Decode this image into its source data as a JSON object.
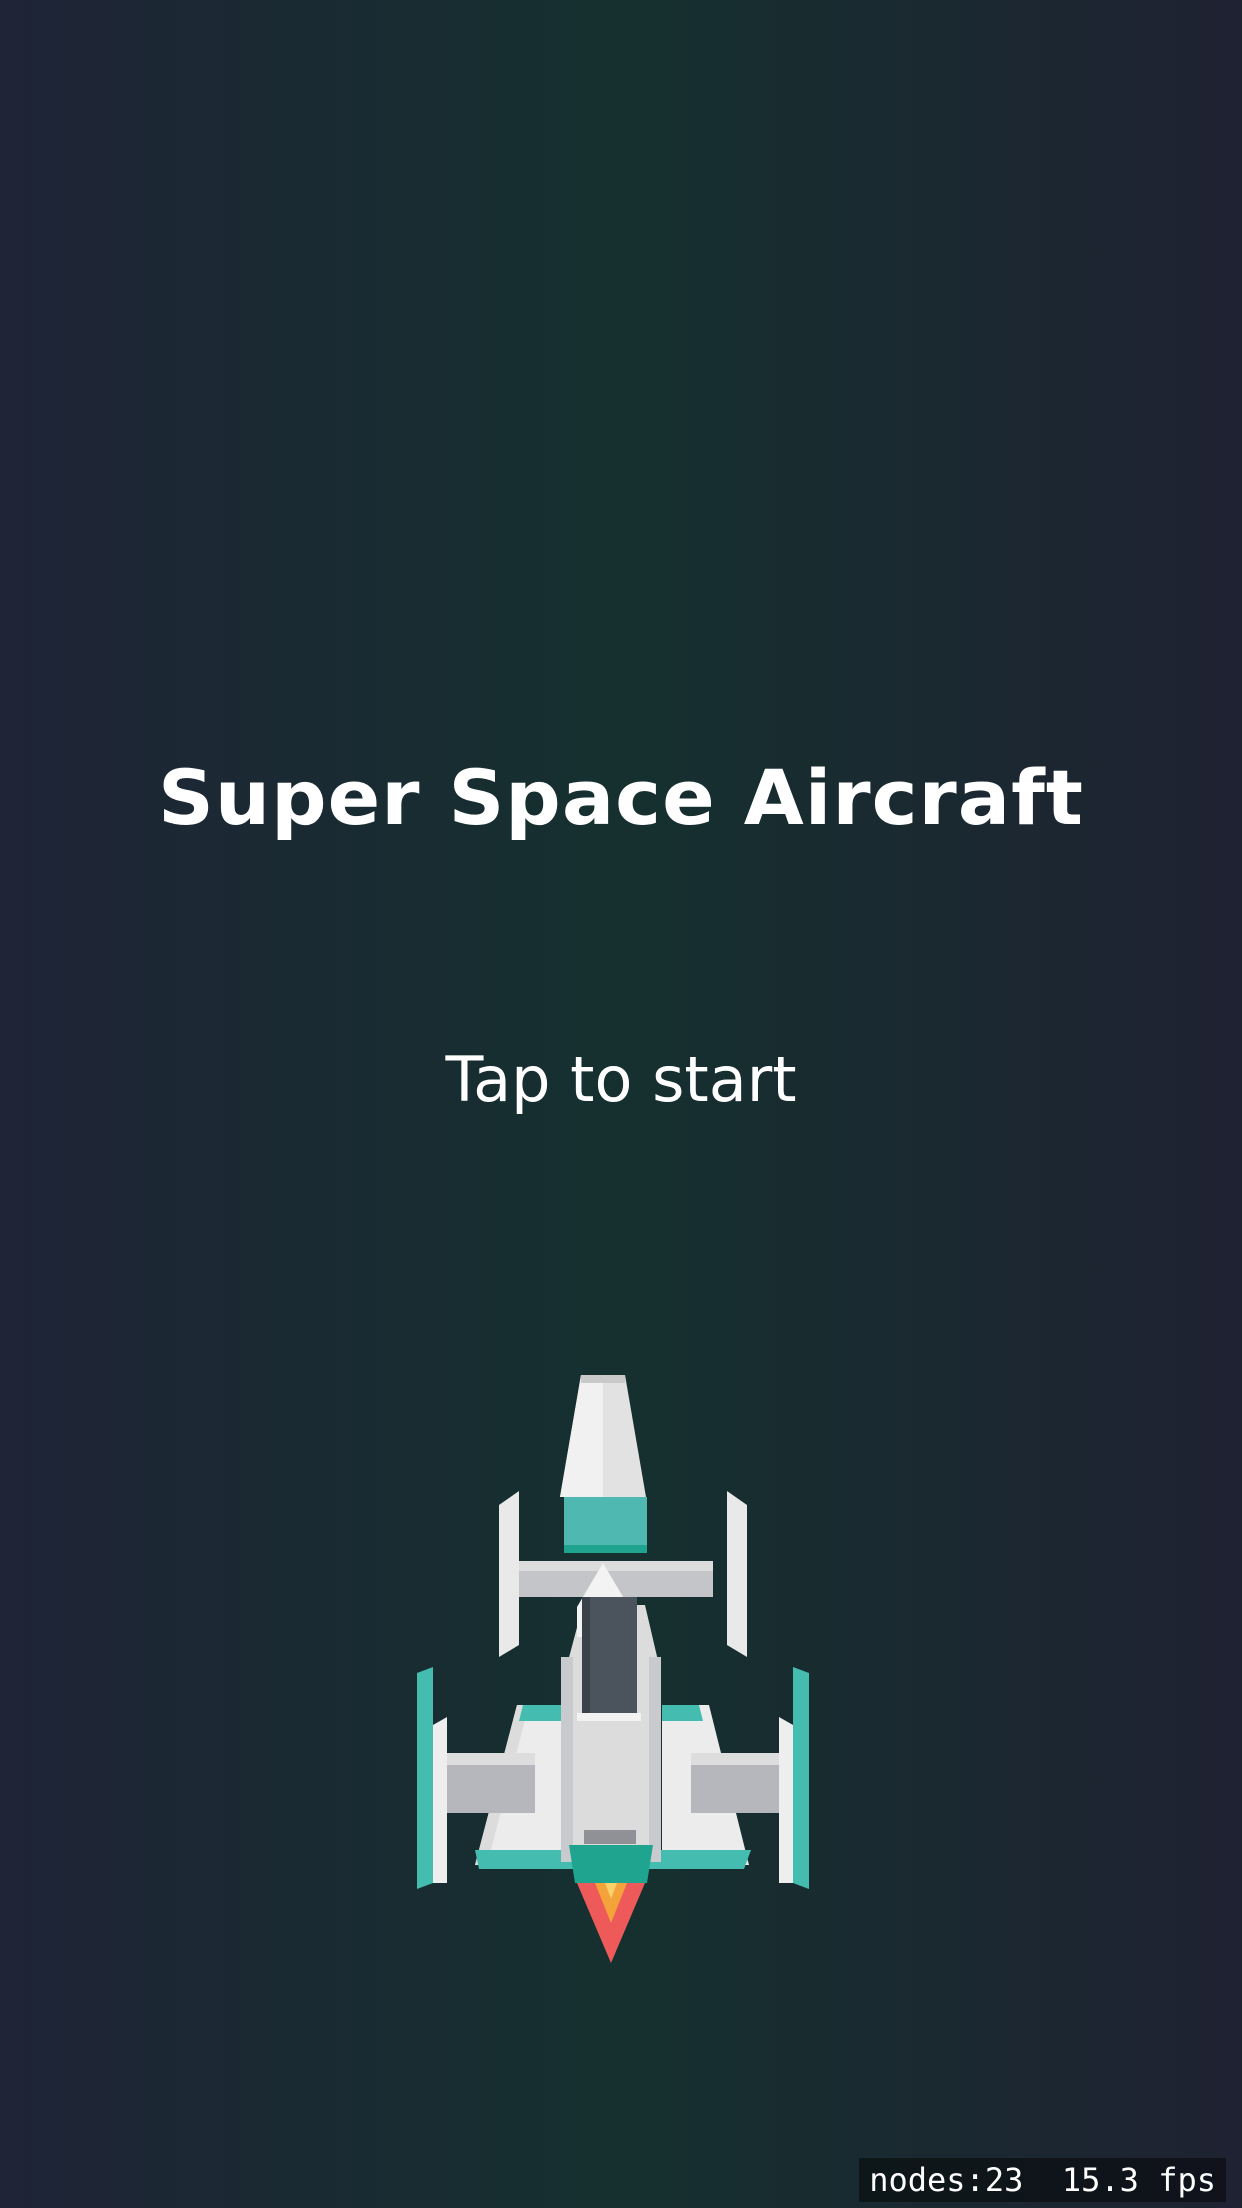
{
  "game": {
    "title": "Super Space Aircraft",
    "prompt": "Tap to start"
  },
  "hud": {
    "nodes_label": "nodes:23",
    "fps_label": "15.3 fps"
  },
  "player_ship": {
    "icon": "spaceship-icon"
  },
  "colors": {
    "background_center": "#15302f",
    "background_edge": "#1f2433",
    "ship_teal": "#45bcb0",
    "ship_white": "#eeeeee",
    "ship_gray": "#b7b8bd",
    "cockpit": "#4b545c",
    "flame_outer": "#ee5a5a",
    "flame_inner": "#f4a23a"
  }
}
